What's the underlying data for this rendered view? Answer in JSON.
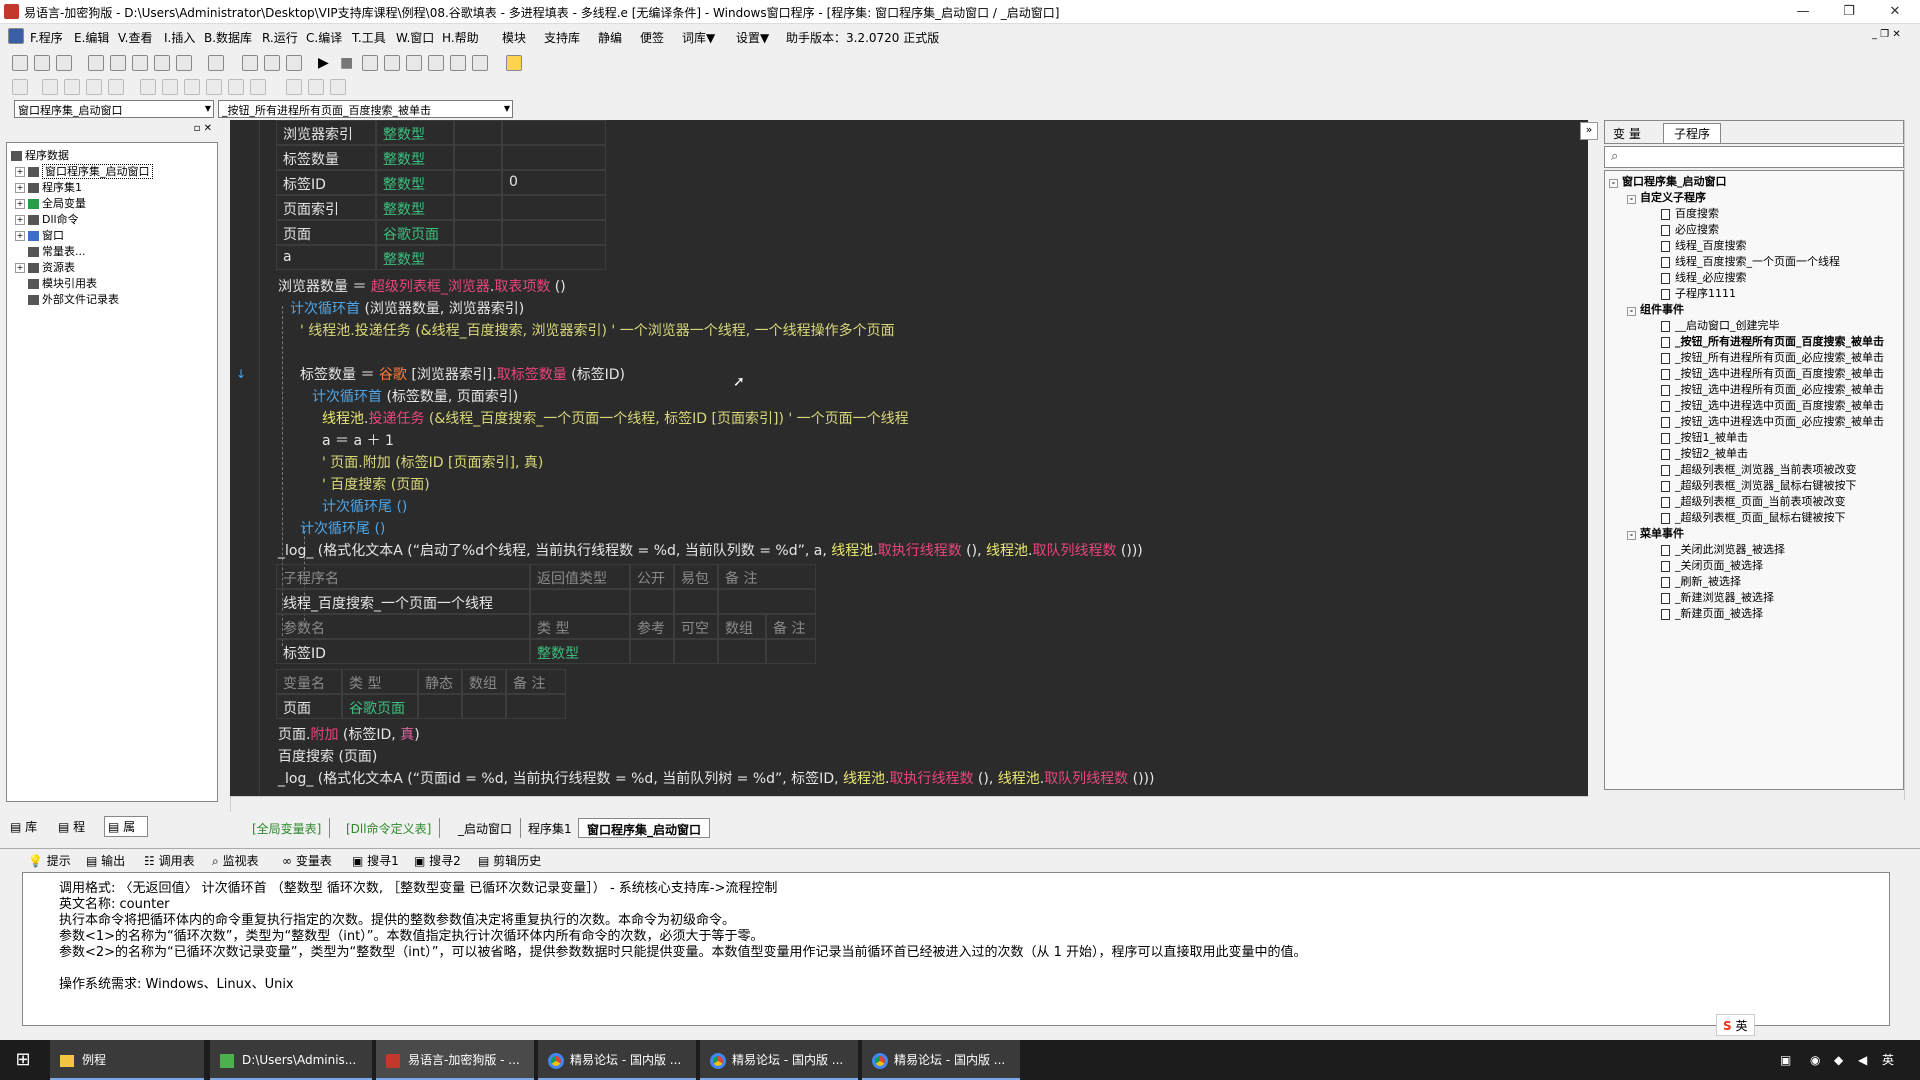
{
  "window": {
    "title": "易语言-加密狗版 - D:\\Users\\Administrator\\Desktop\\VIP支持库课程\\例程\\08.谷歌填表 - 多进程填表 - 多线程.e [无编译条件] - Windows窗口程序 - [程序集: 窗口程序集_启动窗口 / _启动窗口]",
    "min": "—",
    "max": "❐",
    "close": "✕"
  },
  "menu": [
    {
      "label": "F.程序"
    },
    {
      "label": "E.编辑"
    },
    {
      "label": "V.查看"
    },
    {
      "label": "I.插入"
    },
    {
      "label": "B.数据库"
    },
    {
      "label": "R.运行"
    },
    {
      "label": "C.编译"
    },
    {
      "label": "T.工具"
    },
    {
      "label": "W.窗口"
    },
    {
      "label": "H.帮助"
    },
    {
      "label": "模块"
    },
    {
      "label": "支持库"
    },
    {
      "label": "静编"
    },
    {
      "label": "便签"
    },
    {
      "label": "词库▼"
    },
    {
      "label": "设置▼"
    },
    {
      "label": "助手版本：3.2.0720 正式版"
    }
  ],
  "combos": {
    "left": "窗口程序集_启动窗口",
    "right": "_按钮_所有进程所有页面_百度搜索_被单击"
  },
  "lefttree": {
    "root": "程序数据",
    "items": [
      "窗口程序集_启动窗口",
      "程序集1",
      "全局变量",
      "Dll命令",
      "窗口",
      "常量表...",
      "资源表",
      "模块引用表",
      "外部文件记录表"
    ],
    "tabs": [
      "库",
      "程",
      "属"
    ]
  },
  "vartable1": [
    [
      "浏览器索引",
      "整数型",
      ""
    ],
    [
      "标签数量",
      "整数型",
      ""
    ],
    [
      "标签ID",
      "整数型",
      "0"
    ],
    [
      "页面索引",
      "整数型",
      ""
    ],
    [
      "页面",
      "谷歌页面",
      ""
    ],
    [
      "a",
      "整数型",
      ""
    ]
  ],
  "code": {
    "l1a": "浏览器数量 ＝ ",
    "l1b": "超级列表框_浏览器",
    "l1c": ".",
    "l1d": "取表项数",
    "l1e": " ()",
    "l2a": "计次循环首",
    "l2b": " (浏览器数量, 浏览器索引)",
    "l3": "' 线程池.投递任务 (&线程_百度搜索, 浏览器索引)  ' 一个浏览器一个线程, 一个线程操作多个页面",
    "l4a": "标签数量 ＝ ",
    "l4b": "谷歌",
    "l4c": " [浏览器索引].",
    "l4d": "取标签数量",
    "l4e": " (标签ID)",
    "l5a": "计次循环首",
    "l5b": " (标签数量, 页面索引)",
    "l6a": "线程池",
    "l6b": ".",
    "l6c": "投递任务",
    "l6d": " (&线程_百度搜索_一个页面一个线程, 标签ID [页面索引])",
    "l6e": "  ' 一个页面一个线程",
    "l7": "a ＝ a ＋ 1",
    "l8": "' 页面.附加 (标签ID [页面索引], 真)",
    "l9": "' 百度搜索 (页面)",
    "l10": "计次循环尾 ()",
    "l11": "计次循环尾 ()",
    "l12a": "_log_ (格式化文本A (“启动了%d个线程, 当前执行线程数 = %d, 当前队列数 = %d”, a, ",
    "l12b": "线程池",
    "l12c": ".",
    "l12d": "取执行线程数",
    "l12e": " (), ",
    "l12f": "线程池",
    "l12g": ".",
    "l12h": "取队列线程数",
    "l12i": " ()))"
  },
  "subhdr": {
    "c1": "子程序名",
    "c2": "返回值类型",
    "c3": "公开",
    "c4": "易包",
    "c5": "备 注",
    "name": "线程_百度搜索_一个页面一个线程"
  },
  "paramhdr": {
    "c1": "参数名",
    "c2": "类 型",
    "c3": "参考",
    "c4": "可空",
    "c5": "数组",
    "c6": "备 注",
    "p1": "标签ID",
    "p1t": "整数型"
  },
  "varhdr": {
    "c1": "变量名",
    "c2": "类 型",
    "c3": "静态",
    "c4": "数组",
    "c5": "备 注",
    "v1": "页面",
    "v1t": "谷歌页面"
  },
  "code2": {
    "m1a": "页面.",
    "m1b": "附加",
    "m1c": " (标签ID, ",
    "m1d": "真",
    "m1e": ")",
    "m2": "百度搜索 (页面)",
    "m3a": "_log_ (格式化文本A (“页面id = %d, 当前执行线程数 = %d, 当前队列树 = %d”, 标签ID, ",
    "m3b": "线程池",
    "m3c": ".",
    "m3d": "取执行线程数",
    "m3e": " (), ",
    "m3f": "线程池",
    "m3g": ".",
    "m3h": "取队列线程数",
    "m3i": " ()))"
  },
  "righttabs": [
    "变 量",
    "子程序"
  ],
  "righttree": {
    "root": "窗口程序集_启动窗口",
    "g1": "自定义子程序",
    "g1items": [
      "百度搜索",
      "必应搜索",
      "线程_百度搜索",
      "线程_百度搜索_一个页面一个线程",
      "线程_必应搜索",
      "子程序1111"
    ],
    "g2": "组件事件",
    "g2items": [
      "__启动窗口_创建完毕",
      "_按钮_所有进程所有页面_百度搜索_被单击",
      "_按钮_所有进程所有页面_必应搜索_被单击",
      "_按钮_选中进程所有页面_百度搜索_被单击",
      "_按钮_选中进程所有页面_必应搜索_被单击",
      "_按钮_选中进程选中页面_百度搜索_被单击",
      "_按钮_选中进程选中页面_必应搜索_被单击",
      "_按钮1_被单击",
      "_按钮2_被单击",
      "_超级列表框_浏览器_当前表项被改变",
      "_超级列表框_浏览器_鼠标右键被按下",
      "_超级列表框_页面_当前表项被改变",
      "_超级列表框_页面_鼠标右键被按下"
    ],
    "g3": "菜单事件",
    "g3items": [
      "_关闭此浏览器_被选择",
      "_关闭页面_被选择",
      "_刷新_被选择",
      "_新建浏览器_被选择",
      "_新建页面_被选择"
    ]
  },
  "filetabs": [
    "[全局变量表]",
    "[Dll命令定义表]",
    "_启动窗口",
    "程序集1",
    "窗口程序集_启动窗口"
  ],
  "bottomtabs": [
    "提示",
    "输出",
    "调用表",
    "监视表",
    "变量表",
    "搜寻1",
    "搜寻2",
    "剪辑历史"
  ],
  "output": [
    "调用格式: 〈无返回值〉 计次循环首 （整数型 循环次数, ［整数型变量 已循环次数记录变量］） - 系统核心支持库->流程控制",
    "英文名称: counter",
    "执行本命令将把循环体内的命令重复执行指定的次数。提供的整数参数值决定将重复执行的次数。本命令为初级命令。",
    "参数<1>的名称为“循环次数”，类型为“整数型（int）”。本数值指定执行计次循环体内所有命令的次数，必须大于等于零。",
    "参数<2>的名称为“已循环次数记录变量”，类型为“整数型（int）”，可以被省略，提供参数数据时只能提供变量。本数值型变量用作记录当前循环首已经被进入过的次数（从 1 开始），程序可以直接取用此变量中的值。",
    "",
    "操作系统需求:  Windows、Linux、Unix"
  ],
  "ime": "英",
  "taskbar": [
    {
      "label": "例程"
    },
    {
      "label": "D:\\Users\\Adminis..."
    },
    {
      "label": "易语言-加密狗版 - ..."
    },
    {
      "label": "精易论坛 - 国内版 ..."
    },
    {
      "label": "精易论坛 - 国内版 ..."
    },
    {
      "label": "精易论坛 - 国内版 ..."
    }
  ],
  "tray": {
    "lang": "英"
  }
}
